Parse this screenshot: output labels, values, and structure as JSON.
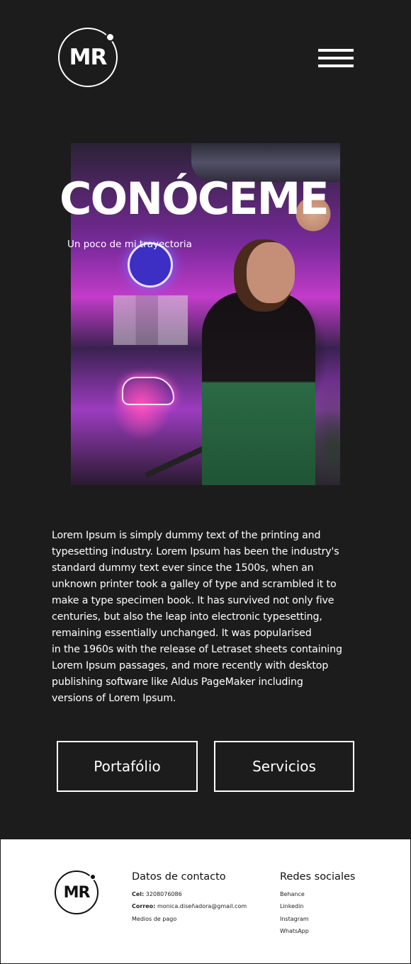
{
  "header": {
    "logo_text": "MR"
  },
  "hero": {
    "title": "CONÓCEME",
    "subtitle": "Un poco de mi trayectoria"
  },
  "about": {
    "text": "Lorem Ipsum is simply dummy text of the printing and\ntypesetting industry. Lorem Ipsum has been the industry's\nstandard dummy text ever since the 1500s, when an\nunknown printer took a galley of type and scrambled it to\nmake a type specimen book. It has survived not only five\ncenturies, but also the leap into electronic typesetting,\nremaining essentially unchanged. It was popularised\nin the 1960s with the release of Letraset sheets containing\nLorem Ipsum passages, and more recently with desktop\npublishing  software like Aldus PageMaker including\nversions of Lorem Ipsum."
  },
  "buttons": {
    "portfolio": "Portafólio",
    "services": "Servicios"
  },
  "footer": {
    "logo_text": "MR",
    "contact": {
      "heading": "Datos de contacto",
      "phone_label": "Cel:",
      "phone_value": "3208076086",
      "email_label": "Correo:",
      "email_value": "monica.diseñadora@gmail.com",
      "payment": "Medios de pago"
    },
    "social": {
      "heading": "Redes sociales",
      "links": [
        "Behance",
        "Linkedin",
        "Instagram",
        "WhatsApp"
      ]
    }
  }
}
